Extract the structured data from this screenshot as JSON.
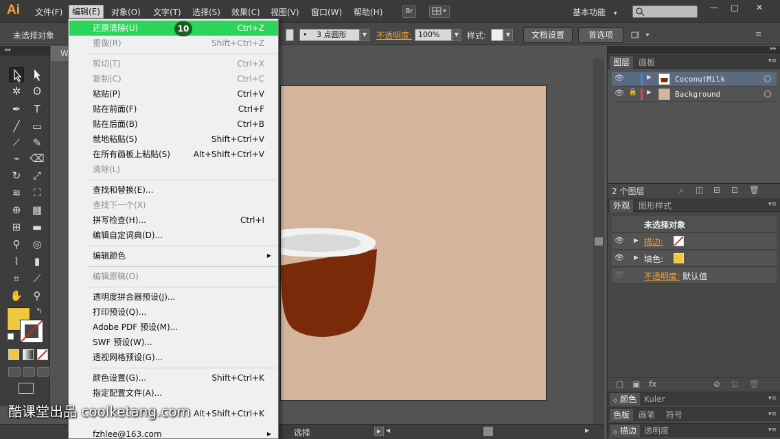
{
  "menubar": {
    "logo": "Ai",
    "items": [
      "文件(F)",
      "编辑(E)",
      "对象(O)",
      "文字(T)",
      "选择(S)",
      "效果(C)",
      "视图(V)",
      "窗口(W)",
      "帮助(H)"
    ],
    "br_button": "Br",
    "workspace": "基本功能",
    "workspace_arrow": "▾",
    "search_placeholder": "",
    "win_minimize": "—",
    "win_maximize": "□",
    "win_close": "✕"
  },
  "controlbar": {
    "selection_status": "未选择对象",
    "brush_dot": "•",
    "brush_value": "3 点圆形",
    "opacity_label": "不透明度:",
    "opacity_value": "100%",
    "style_label": "样式:",
    "doc_setup": "文档设置",
    "preferences": "首选项"
  },
  "document": {
    "tab_label": "W",
    "status_text": "选择"
  },
  "layers_panel": {
    "tabs": [
      "图层",
      "画板"
    ],
    "layers": [
      {
        "name": "CoconutMilk",
        "color": "#4a7fd8"
      },
      {
        "name": "Background",
        "color": "#d84a4a"
      }
    ],
    "count_label": "2 个图层"
  },
  "appearance_panel": {
    "tabs": [
      "外观",
      "图形样式"
    ],
    "header": "未选择对象",
    "stroke_label": "描边:",
    "fill_label": "填色:",
    "opacity_label": "不透明度:",
    "opacity_value": "默认值",
    "fill_color": "#f0c840"
  },
  "collapsed_panels": {
    "color_tabs": [
      "颜色",
      "Kuler"
    ],
    "swatch_tabs": [
      "色板",
      "画笔",
      "符号"
    ],
    "stroke_tabs": [
      "描边",
      "透明度"
    ]
  },
  "edit_menu": {
    "items": [
      {
        "label": "还原清除(U)",
        "shortcut": "Ctrl+Z",
        "state": "highlight"
      },
      {
        "label": "重做(R)",
        "shortcut": "Shift+Ctrl+Z",
        "state": "disabled"
      },
      {
        "label": "剪切(T)",
        "shortcut": "Ctrl+X",
        "state": "disabled"
      },
      {
        "label": "复制(C)",
        "shortcut": "Ctrl+C",
        "state": "disabled"
      },
      {
        "label": "粘贴(P)",
        "shortcut": "Ctrl+V",
        "state": "normal"
      },
      {
        "label": "贴在前面(F)",
        "shortcut": "Ctrl+F",
        "state": "normal"
      },
      {
        "label": "贴在后面(B)",
        "shortcut": "Ctrl+B",
        "state": "normal"
      },
      {
        "label": "就地粘贴(S)",
        "shortcut": "Shift+Ctrl+V",
        "state": "normal"
      },
      {
        "label": "在所有画板上粘贴(S)",
        "shortcut": "Alt+Shift+Ctrl+V",
        "state": "normal"
      },
      {
        "label": "清除(L)",
        "shortcut": "",
        "state": "disabled"
      },
      {
        "label": "查找和替换(E)...",
        "shortcut": "",
        "state": "normal"
      },
      {
        "label": "查找下一个(X)",
        "shortcut": "",
        "state": "disabled"
      },
      {
        "label": "拼写检查(H)...",
        "shortcut": "Ctrl+I",
        "state": "normal"
      },
      {
        "label": "编辑自定词典(D)...",
        "shortcut": "",
        "state": "normal"
      },
      {
        "label": "编辑颜色",
        "shortcut": "",
        "state": "normal"
      },
      {
        "label": "编辑原稿(O)",
        "shortcut": "",
        "state": "disabled"
      },
      {
        "label": "透明度拼合器预设(J)...",
        "shortcut": "",
        "state": "normal"
      },
      {
        "label": "打印预设(Q)...",
        "shortcut": "",
        "state": "normal"
      },
      {
        "label": "Adobe PDF 预设(M)...",
        "shortcut": "",
        "state": "normal"
      },
      {
        "label": "SWF 预设(W)...",
        "shortcut": "",
        "state": "normal"
      },
      {
        "label": "透视网格预设(G)...",
        "shortcut": "",
        "state": "normal"
      },
      {
        "label": "颜色设置(G)...",
        "shortcut": "Shift+Ctrl+K",
        "state": "normal"
      },
      {
        "label": "指定配置文件(A)...",
        "shortcut": "",
        "state": "normal"
      },
      {
        "label": "",
        "shortcut": "Alt+Shift+Ctrl+K",
        "state": "normal"
      },
      {
        "label": "fzhlee@163.com",
        "shortcut": "",
        "state": "normal"
      }
    ],
    "step_badge": "10",
    "submenu_arrow": "▶"
  },
  "tools": {
    "header": "◂◂",
    "fill_color": "#f0c840"
  },
  "artwork": {
    "cup_color": "#7a2a08",
    "milk_color": "#f2f2f2",
    "milk_inner": "#d9d9d9"
  },
  "watermark": "酷课堂出品 coolketang.com"
}
